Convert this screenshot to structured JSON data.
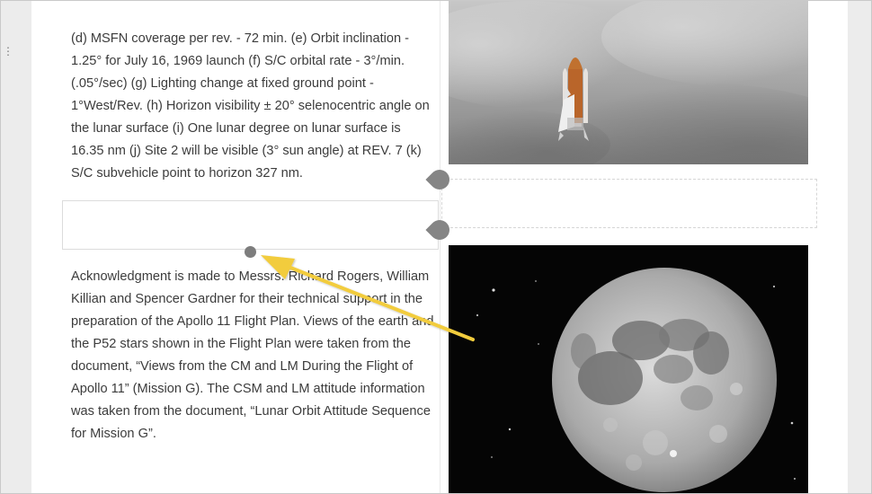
{
  "text_fragment_top": "min.",
  "paragraph_1": "(d) MSFN coverage per rev. - 72 min. (e) Orbit inclination - 1.25° for July 16, 1969 launch (f) S/C orbital rate - 3°/min. (.05°/sec) (g) Lighting change at fixed ground point - 1°West/Rev. (h) Horizon visibility ± 20° selenocentric angle on the lunar surface (i) One lunar degree on lunar surface is 16.35 nm (j) Site 2 will be visible (3° sun angle) at REV. 7 (k) S/C subvehicle point to horizon 327 nm.",
  "paragraph_2": "Acknowledgment is made to Messrs. Richard Rogers, William Killian and Spencer Gardner for their technical support in the preparation of the Apollo 11 Flight Plan. Views of the earth and the P52 stars shown in the Flight Plan were taken from the document, “Views from the CM and LM During the Flight of Apollo 11” (Mission G). The CSM and LM attitude information was taken from the document, “Lunar Orbit Attitude Sequence for Mission G”.",
  "images": {
    "top": "space-shuttle-launch-photo",
    "bottom": "full-moon-photo"
  },
  "colors": {
    "annotation_arrow": "#f2cc3d",
    "drop_marker": "#858585"
  }
}
